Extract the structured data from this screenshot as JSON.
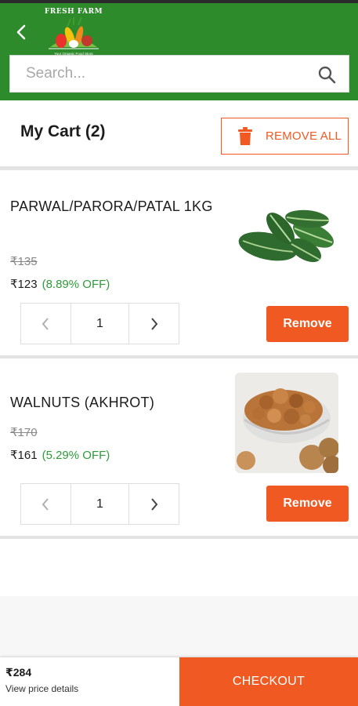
{
  "header": {
    "back_icon": "chevron-left-icon",
    "logo_brand": "FRESH FARM",
    "logo_tagline": "Your Organic Food Store",
    "brand_color": "#2e8b2b"
  },
  "search": {
    "placeholder": "Search...",
    "value": "",
    "icon": "search-icon"
  },
  "cart": {
    "title": "My Cart (2)",
    "remove_all_label": "REMOVE ALL",
    "remove_all_icon": "trash-icon",
    "accent_color": "#f05a22"
  },
  "items": [
    {
      "name": "PARWAL/PARORA/PATAL 1KG",
      "old_price": "₹135",
      "price": "₹123",
      "discount": "(8.89% OFF)",
      "quantity": "1",
      "remove_label": "Remove",
      "image": "parwal-vegetable-image"
    },
    {
      "name": "WALNUTS (AKHROT)",
      "old_price": "₹170",
      "price": "₹161",
      "discount": "(5.29% OFF)",
      "quantity": "1",
      "remove_label": "Remove",
      "image": "walnuts-image"
    }
  ],
  "footer": {
    "total": "₹284",
    "details_link": "View price details",
    "checkout_label": "CHECKOUT"
  }
}
